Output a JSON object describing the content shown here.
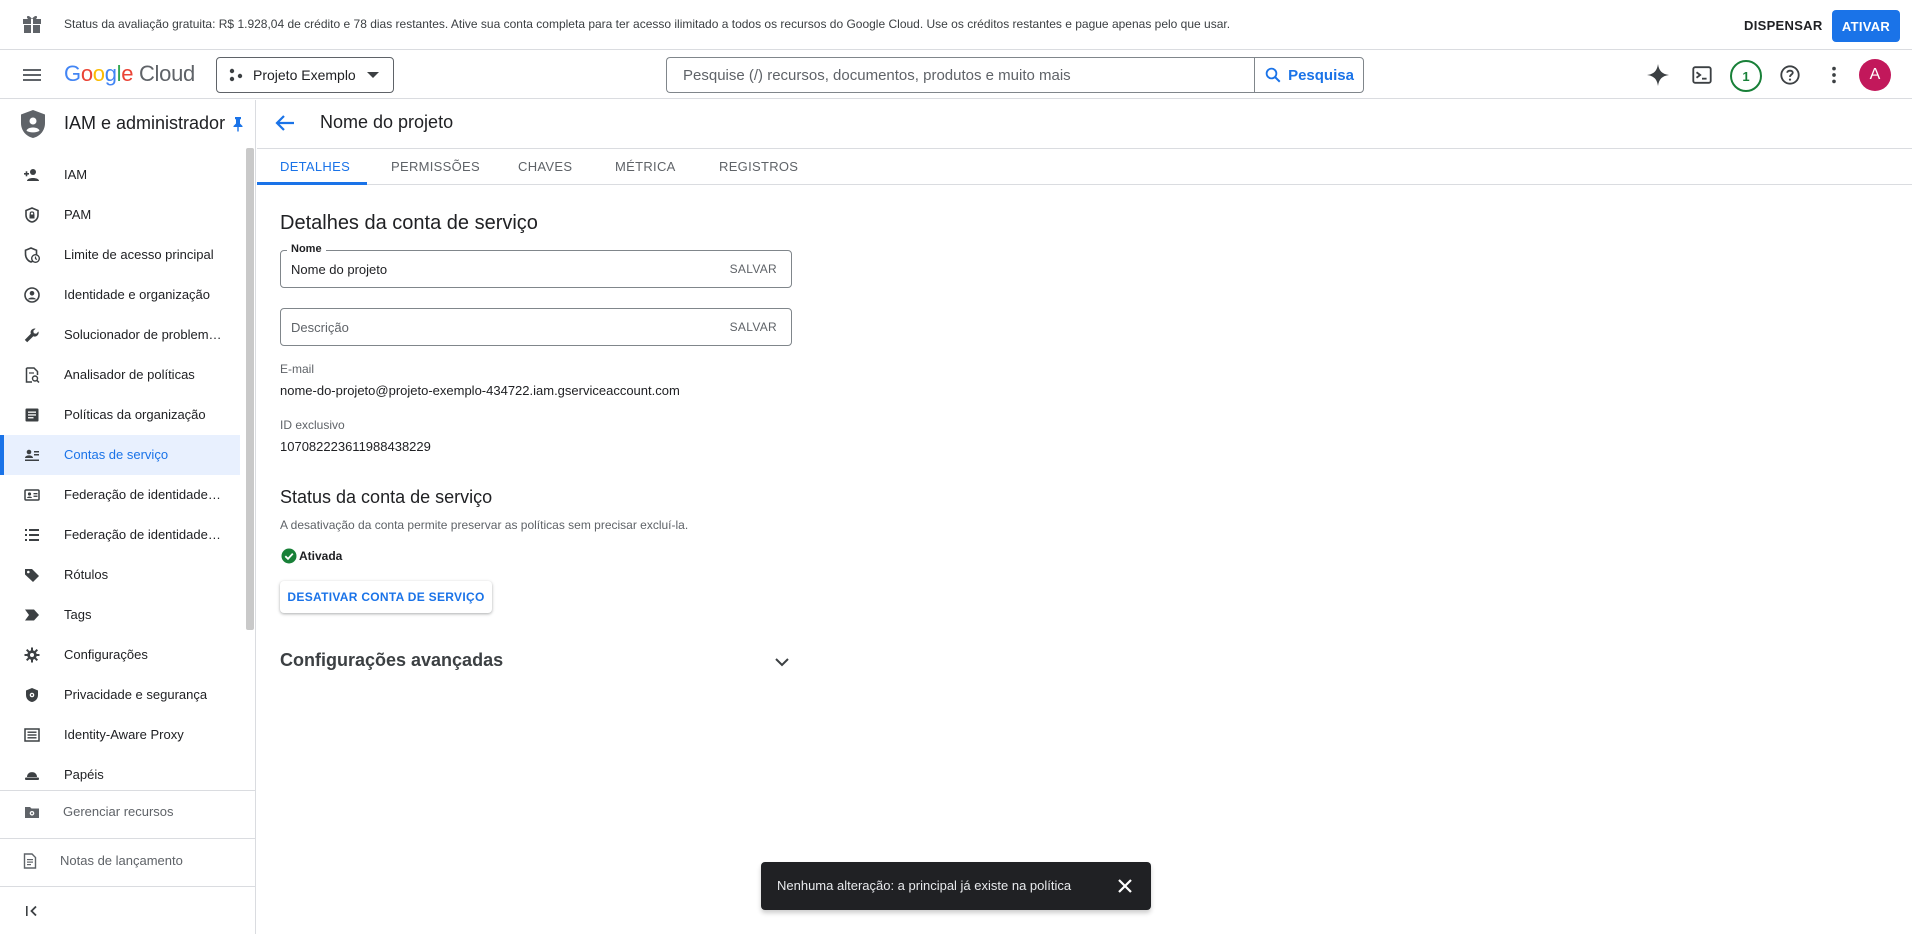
{
  "banner": {
    "text": "Status da avaliação gratuita: R$ 1.928,04 de crédito e 78 dias restantes. Ative sua conta completa para ter acesso ilimitado a todos os recursos do Google Cloud. Use os créditos restantes e pague apenas pelo que usar.",
    "dismiss_label": "DISPENSAR",
    "activate_label": "ATIVAR"
  },
  "topbar": {
    "logo_google": "Google",
    "logo_cloud": "Cloud",
    "project": "Projeto Exemplo",
    "search_placeholder": "Pesquise (/) recursos, documentos, produtos e muito mais",
    "search_button": "Pesquisa",
    "notification_count": "1",
    "avatar_letter": "A"
  },
  "sidebar": {
    "title": "IAM e administrador",
    "items": [
      {
        "label": "IAM",
        "icon": "person-add-icon"
      },
      {
        "label": "PAM",
        "icon": "shield-lock-icon"
      },
      {
        "label": "Limite de acesso principal",
        "icon": "shield-clock-icon"
      },
      {
        "label": "Identidade e organização",
        "icon": "account-circle-icon"
      },
      {
        "label": "Solucionador de problemas de política",
        "icon": "wrench-icon"
      },
      {
        "label": "Analisador de políticas",
        "icon": "policy-doc-icon"
      },
      {
        "label": "Políticas da organização",
        "icon": "article-icon"
      },
      {
        "label": "Contas de serviço",
        "icon": "service-account-icon"
      },
      {
        "label": "Federação de identidade da força de trabalho",
        "icon": "badge-icon"
      },
      {
        "label": "Federação de identidade da carga de trabalho",
        "icon": "list-icon"
      },
      {
        "label": "Rótulos",
        "icon": "label-icon"
      },
      {
        "label": "Tags",
        "icon": "tag-chevron-icon"
      },
      {
        "label": "Configurações",
        "icon": "gear-icon"
      },
      {
        "label": "Privacidade e segurança",
        "icon": "shield-gear-icon"
      },
      {
        "label": "Identity-Aware Proxy",
        "icon": "proxy-icon"
      },
      {
        "label": "Papéis",
        "icon": "hat-icon"
      }
    ],
    "active_index": 7,
    "footer": {
      "manage_resources": "Gerenciar recursos",
      "release_notes": "Notas de lançamento"
    }
  },
  "page": {
    "title": "Nome do projeto",
    "tabs": [
      "DETALHES",
      "PERMISSÕES",
      "CHAVES",
      "MÉTRICA",
      "REGISTROS"
    ],
    "active_tab": 0,
    "details_heading": "Detalhes da conta de serviço",
    "name_label": "Nome",
    "name_value": "Nome do projeto",
    "save_label": "SALVAR",
    "description_placeholder": "Descrição",
    "email_label": "E-mail",
    "email_value": "nome-do-projeto@projeto-exemplo-434722.iam.gserviceaccount.com",
    "unique_id_label": "ID exclusivo",
    "unique_id_value": "107082223611988438229",
    "status_heading": "Status da conta de serviço",
    "status_description": "A desativação da conta permite preservar as políticas sem precisar excluí-la.",
    "status_value": "Ativada",
    "disable_button": "DESATIVAR CONTA DE SERVIÇO",
    "advanced_heading": "Configurações avançadas"
  },
  "snackbar": {
    "message": "Nenhuma alteração: a principal já existe na política"
  },
  "colors": {
    "accent": "#1a73e8",
    "success": "#188038",
    "avatar": "#c2185b"
  }
}
